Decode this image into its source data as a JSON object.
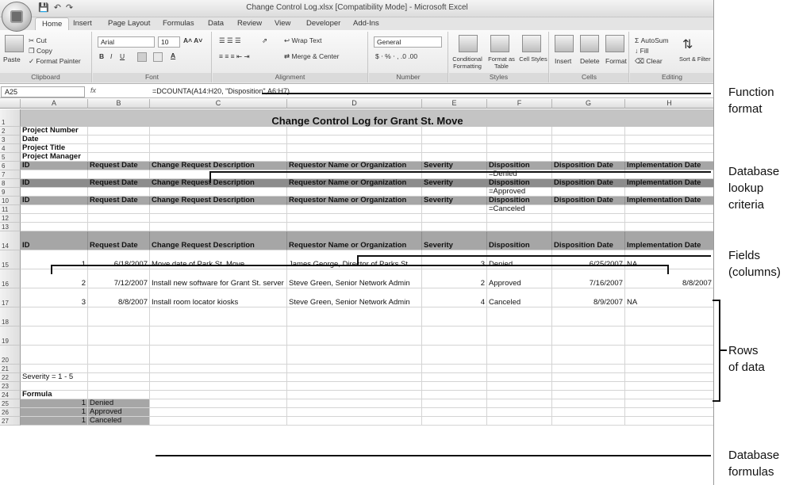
{
  "window": {
    "title": "Change Control Log.xlsx  [Compatibility Mode] - Microsoft Excel"
  },
  "ribbon": {
    "tabs": [
      "Home",
      "Insert",
      "Page Layout",
      "Formulas",
      "Data",
      "Review",
      "View",
      "Developer",
      "Add-Ins"
    ],
    "clipboard": {
      "paste": "Paste",
      "cut": "Cut",
      "copy": "Copy",
      "format_painter": "Format Painter",
      "label": "Clipboard"
    },
    "font": {
      "name": "Arial",
      "size": "10",
      "label": "Font"
    },
    "alignment": {
      "wrap": "Wrap Text",
      "merge": "Merge & Center",
      "label": "Alignment"
    },
    "number": {
      "format": "General",
      "label": "Number"
    },
    "styles": {
      "conditional": "Conditional Formatting",
      "format_table": "Format as Table",
      "cell_styles": "Cell Styles",
      "label": "Styles"
    },
    "cells": {
      "insert": "Insert",
      "delete": "Delete",
      "format": "Format",
      "label": "Cells"
    },
    "editing": {
      "autosum": "AutoSum",
      "fill": "Fill",
      "clear": "Clear",
      "sort": "Sort & Filter",
      "label": "Editing"
    }
  },
  "formula_bar": {
    "name_box": "A25",
    "fx": "fx",
    "formula": "=DCOUNTA(A14:H20, \"Disposition\",A6:H7)"
  },
  "columns": [
    "A",
    "B",
    "C",
    "D",
    "E",
    "F",
    "G",
    "H"
  ],
  "sheet": {
    "title": "Change Control Log for Grant St. Move",
    "info_labels": [
      "Project Number",
      "Date",
      "Project Title",
      "Project Manager"
    ],
    "headers": [
      "ID",
      "Request Date",
      "Change Request Description",
      "Requestor Name or Organization",
      "Severity",
      "Disposition",
      "Disposition Date",
      "Implementation Date"
    ],
    "criteria": [
      "=Denied",
      "=Approved",
      "=Canceled"
    ],
    "data_rows": [
      {
        "id": "1",
        "date": "6/18/2007",
        "desc": "Move date of Park St. Move",
        "req": "James George, Director of Parks St.",
        "sev": "3",
        "disp": "Denied",
        "ddate": "6/25/2007",
        "impl": "NA"
      },
      {
        "id": "2",
        "date": "7/12/2007",
        "desc": "Install new software for Grant St. server",
        "req": "Steve Green, Senior Network Admin",
        "sev": "2",
        "disp": "Approved",
        "ddate": "7/16/2007",
        "impl": "8/8/2007"
      },
      {
        "id": "3",
        "date": "8/8/2007",
        "desc": "Install room locator kiosks",
        "req": "Steve Green, Senior Network Admin",
        "sev": "4",
        "disp": "Canceled",
        "ddate": "8/9/2007",
        "impl": "NA"
      }
    ],
    "severity_note": "Severity = 1 - 5",
    "formula_label": "Formula",
    "formula_results": [
      {
        "count": "1",
        "label": "Denied"
      },
      {
        "count": "1",
        "label": "Approved"
      },
      {
        "count": "1",
        "label": "Canceled"
      }
    ]
  },
  "annotations": {
    "function_format": [
      "Function",
      "format"
    ],
    "lookup_criteria": [
      "Database",
      "lookup",
      "criteria"
    ],
    "fields": [
      "Fields",
      "(columns)"
    ],
    "rows": [
      "Rows",
      "of data"
    ],
    "formulas": [
      "Database",
      "formulas"
    ]
  }
}
